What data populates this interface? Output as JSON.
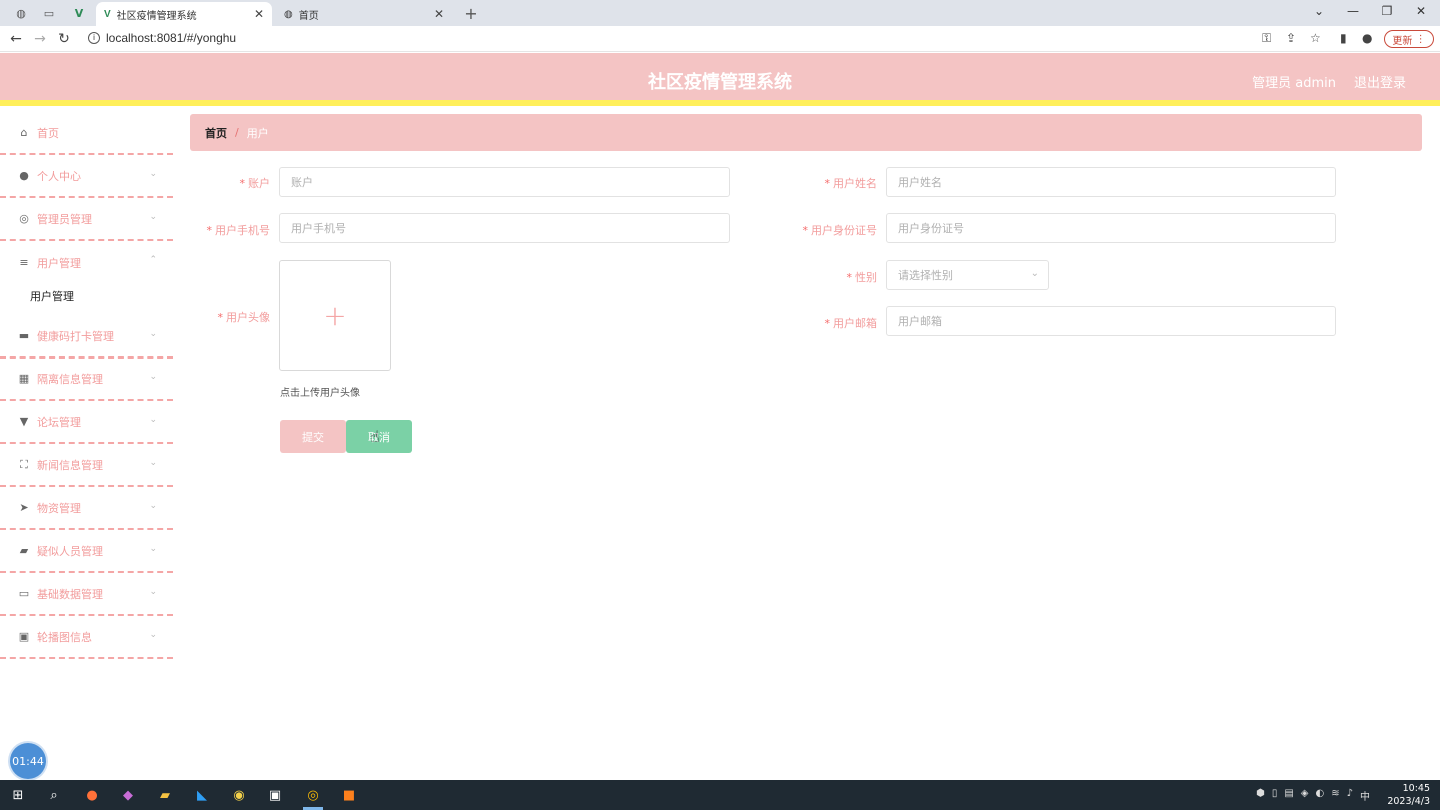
{
  "browser": {
    "tabs": [
      {
        "title": "社区疫情管理系统",
        "active": true
      },
      {
        "title": "首页",
        "active": false
      }
    ],
    "new_tab": "+",
    "url": "localhost:8081/#/yonghu",
    "update_label": "更新"
  },
  "header": {
    "title": "社区疫情管理系统",
    "user_label": "管理员 admin",
    "logout_label": "退出登录",
    "bg_color": "#f4c4c4",
    "accent_color": "#ffef5a"
  },
  "sidebar": {
    "items": [
      {
        "label": "首页",
        "icon": "home-icon"
      },
      {
        "label": "个人中心",
        "icon": "user-icon"
      },
      {
        "label": "管理员管理",
        "icon": "admin-icon"
      },
      {
        "label": "用户管理",
        "icon": "sliders-icon"
      },
      {
        "label": "健康码打卡管理",
        "icon": "briefcase-icon"
      },
      {
        "label": "隔离信息管理",
        "icon": "grid-icon"
      },
      {
        "label": "论坛管理",
        "icon": "thumb-icon"
      },
      {
        "label": "新闻信息管理",
        "icon": "fullscreen-icon"
      },
      {
        "label": "物资管理",
        "icon": "send-icon"
      },
      {
        "label": "疑似人员管理",
        "icon": "ticket-icon"
      },
      {
        "label": "基础数据管理",
        "icon": "monitor-icon"
      },
      {
        "label": "轮播图信息",
        "icon": "trash-icon"
      }
    ],
    "submenu": {
      "label": "用户管理"
    }
  },
  "breadcrumb": {
    "home": "首页",
    "separator": "/",
    "current": "用户"
  },
  "form": {
    "account": {
      "label": "账户",
      "placeholder": "账户"
    },
    "phone": {
      "label": "用户手机号",
      "placeholder": "用户手机号"
    },
    "avatar": {
      "label": "用户头像",
      "tip": "点击上传用户头像",
      "plus": "+"
    },
    "name": {
      "label": "用户姓名",
      "placeholder": "用户姓名"
    },
    "id_card": {
      "label": "用户身份证号",
      "placeholder": "用户身份证号"
    },
    "gender": {
      "label": "性别",
      "placeholder": "请选择性别"
    },
    "email": {
      "label": "用户邮箱",
      "placeholder": "用户邮箱"
    },
    "required_mark": "*",
    "submit_label": "提交",
    "cancel_label": "取消"
  },
  "timer": "01:44",
  "taskbar": {
    "time": "10:45",
    "date": "2023/4/3",
    "ime": "中"
  }
}
